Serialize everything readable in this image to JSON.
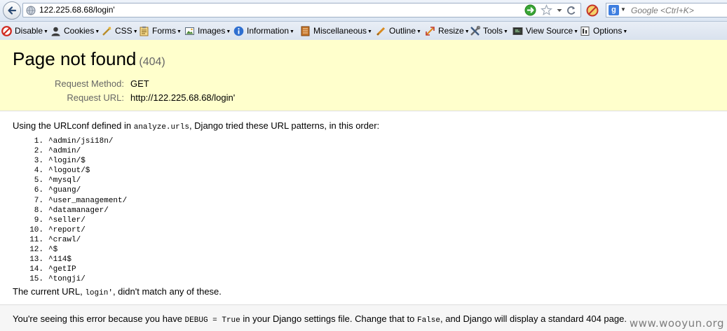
{
  "browser": {
    "url": "122.225.68.68/login'",
    "search_placeholder": "Google <Ctrl+K>"
  },
  "toolbar": {
    "items": [
      {
        "label": "Disable",
        "icon": "disable-icon"
      },
      {
        "label": "Cookies",
        "icon": "cookies-icon"
      },
      {
        "label": "CSS",
        "icon": "css-icon"
      },
      {
        "label": "Forms",
        "icon": "forms-icon"
      },
      {
        "label": "Images",
        "icon": "images-icon"
      },
      {
        "label": "Information",
        "icon": "information-icon"
      },
      {
        "label": "Miscellaneous",
        "icon": "miscellaneous-icon"
      },
      {
        "label": "Outline",
        "icon": "outline-icon"
      },
      {
        "label": "Resize",
        "icon": "resize-icon"
      },
      {
        "label": "Tools",
        "icon": "tools-icon"
      },
      {
        "label": "View Source",
        "icon": "view-source-icon"
      },
      {
        "label": "Options",
        "icon": "options-icon"
      }
    ]
  },
  "summary": {
    "title": "Page not found",
    "code": "(404)",
    "request_method_label": "Request Method:",
    "request_method": "GET",
    "request_url_label": "Request URL:",
    "request_url": "http://122.225.68.68/login'"
  },
  "info": {
    "intro_before": "Using the URLconf defined in ",
    "intro_module": "analyze.urls",
    "intro_after": ", Django tried these URL patterns, in this order:",
    "patterns": [
      "^admin/jsi18n/",
      "^admin/",
      "^login/$",
      "^logout/$",
      "^mysql/",
      "^guang/",
      "^user_management/",
      "^datamanager/",
      "^seller/",
      "^report/",
      "^crawl/",
      "^$",
      "^114$",
      "^getIP",
      "^tongji/"
    ],
    "nomatch_before": "The current URL, ",
    "nomatch_url": "login'",
    "nomatch_after": ", didn't match any of these."
  },
  "explanation": {
    "part1": "You're seeing this error because you have ",
    "debug_code": "DEBUG = True",
    "part2": " in your Django settings file. Change that to ",
    "false_code": "False",
    "part3": ", and Django will display a standard 404 page."
  },
  "watermark": "www.wooyun.org"
}
